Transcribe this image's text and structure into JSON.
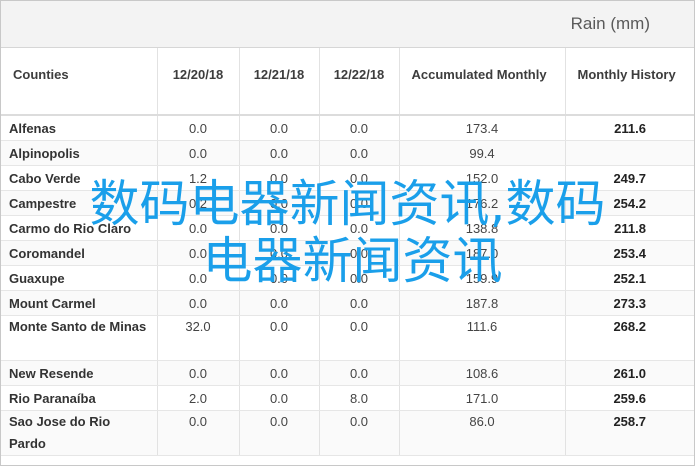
{
  "header": {
    "title": "Rain (mm)"
  },
  "columns": [
    "Counties",
    "12/20/18",
    "12/21/18",
    "12/22/18",
    "Accumulated Monthly",
    "Monthly History"
  ],
  "rows": [
    {
      "county": "Alfenas",
      "d1": "0.0",
      "d2": "0.0",
      "d3": "0.0",
      "acc": "173.4",
      "hist": "211.6"
    },
    {
      "county": "Alpinopolis",
      "d1": "0.0",
      "d2": "0.0",
      "d3": "0.0",
      "acc": "99.4",
      "hist": ""
    },
    {
      "county": "Cabo Verde",
      "d1": "1.2",
      "d2": "0.0",
      "d3": "0.0",
      "acc": "152.0",
      "hist": "249.7"
    },
    {
      "county": "Campestre",
      "d1": "0.2",
      "d2": "0.0",
      "d3": "0.0",
      "acc": "176.2",
      "hist": "254.2"
    },
    {
      "county": "Carmo do Rio Claro",
      "d1": "0.0",
      "d2": "0.0",
      "d3": "0.0",
      "acc": "138.8",
      "hist": "211.8"
    },
    {
      "county": "Coromandel",
      "d1": "0.0",
      "d2": "0.0",
      "d3": "0.0",
      "acc": "187.0",
      "hist": "253.4"
    },
    {
      "county": "Guaxupe",
      "d1": "0.0",
      "d2": "0.0",
      "d3": "0.0",
      "acc": "159.9",
      "hist": "252.1"
    },
    {
      "county": "Mount Carmel",
      "d1": "0.0",
      "d2": "0.0",
      "d3": "0.0",
      "acc": "187.8",
      "hist": "273.3"
    },
    {
      "county": "Monte Santo de Minas",
      "d1": "32.0",
      "d2": "0.0",
      "d3": "0.0",
      "acc": "111.6",
      "hist": "268.2"
    },
    {
      "county": "New Resende",
      "d1": "0.0",
      "d2": "0.0",
      "d3": "0.0",
      "acc": "108.6",
      "hist": "261.0"
    },
    {
      "county": "Rio Paranaíba",
      "d1": "2.0",
      "d2": "0.0",
      "d3": "8.0",
      "acc": "171.0",
      "hist": "259.6"
    },
    {
      "county": "Sao Jose do Rio Pardo",
      "d1": "0.0",
      "d2": "0.0",
      "d3": "0.0",
      "acc": "86.0",
      "hist": "258.7"
    }
  ],
  "watermark": {
    "line1": "数码电器新闻资讯,数码",
    "line2": "电器新闻资讯"
  },
  "colors": {
    "watermark": "#1a9fea",
    "header_bg": "#f3f3f3"
  }
}
